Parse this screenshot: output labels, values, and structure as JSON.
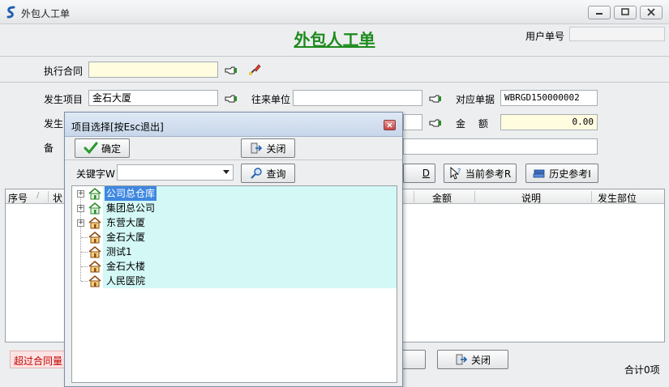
{
  "window": {
    "title": "外包人工单"
  },
  "form": {
    "title": "外包人工单",
    "user_no_label": "用户单号",
    "user_no_value": "",
    "contract_label": "执行合同",
    "contract_value": "",
    "project_label": "发生项目",
    "project_value": "金石大厦",
    "partner_label": "往来单位",
    "partner_value": "",
    "ref_doc_label": "对应单据",
    "ref_doc_value": "WBRGD150000002",
    "row2_label_partial": "发生",
    "amount_label": "金　 额",
    "amount_value": "0.00",
    "remark_label_partial": "备",
    "remark_value": ""
  },
  "toolbar": {
    "partial_button_label": "D",
    "current_ref_label": "当前参考R",
    "history_ref_label": "历史参考I"
  },
  "grid": {
    "columns": [
      "序号",
      "状",
      "金额",
      "说明",
      "发生部位"
    ],
    "rows": []
  },
  "footer": {
    "over_contract_label": "超过合同量",
    "close_label": "关闭",
    "total_label": "合计0项"
  },
  "dialog": {
    "title": "项目选择[按Esc退出]",
    "confirm_label": "确定",
    "close_label": "关闭",
    "keyword_label": "关键字W",
    "keyword_value": "",
    "query_label": "查询",
    "tree": [
      {
        "label": "公司总仓库",
        "expandable": true,
        "selected": true,
        "icon": "house-green-icon"
      },
      {
        "label": "集团总公司",
        "expandable": true,
        "selected": false,
        "icon": "house-green-icon"
      },
      {
        "label": "东营大厦",
        "expandable": true,
        "selected": false,
        "icon": "house-icon"
      },
      {
        "label": "金石大厦",
        "expandable": false,
        "selected": false,
        "icon": "house-icon"
      },
      {
        "label": "测试1",
        "expandable": false,
        "selected": false,
        "icon": "house-icon"
      },
      {
        "label": "金石大楼",
        "expandable": false,
        "selected": false,
        "icon": "house-icon"
      },
      {
        "label": "人民医院",
        "expandable": false,
        "selected": false,
        "icon": "house-icon"
      }
    ]
  },
  "colors": {
    "title_green": "#1c8a1c",
    "selection_blue": "#3f88e1",
    "tree_highlight": "#d3f8f6",
    "warn_red": "#c00000"
  }
}
